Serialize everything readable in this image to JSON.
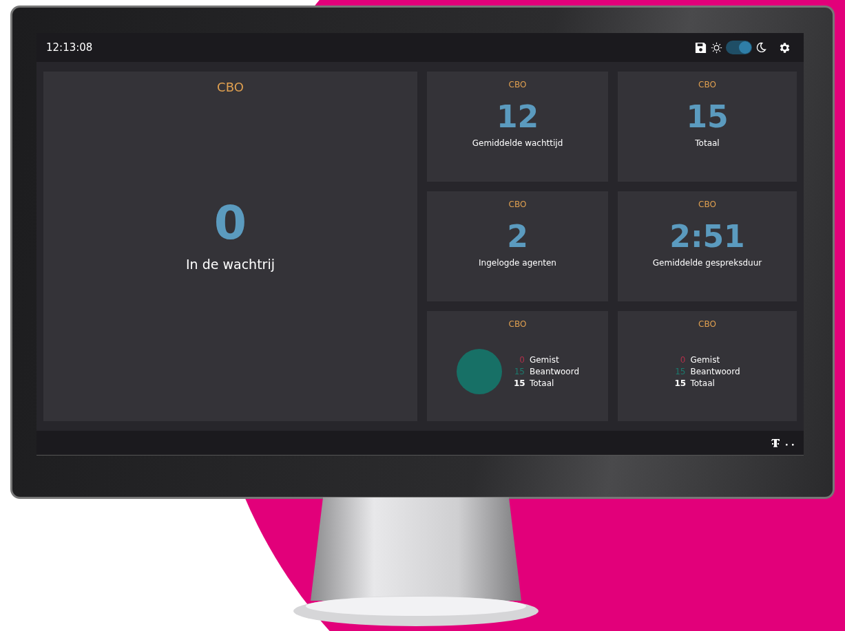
{
  "header": {
    "clock": "12:13:08",
    "dark_mode_toggle": {
      "on": true
    }
  },
  "main_panel": {
    "title": "CBO",
    "value": "0",
    "label": "In de wachtrij"
  },
  "stat_cards": [
    {
      "title": "CBO",
      "value": "12",
      "label": "Gemiddelde wachttijd"
    },
    {
      "title": "CBO",
      "value": "15",
      "label": "Totaal"
    },
    {
      "title": "CBO",
      "value": "2",
      "label": "Ingelogde agenten"
    },
    {
      "title": "CBO",
      "value": "2:51",
      "label": "Gemiddelde gespreksduur"
    }
  ],
  "summary_cards": [
    {
      "title": "CBO",
      "kind": "pie",
      "rows": [
        {
          "kind": "missed",
          "count": "0",
          "label": "Gemist"
        },
        {
          "kind": "answered",
          "count": "15",
          "label": "Beantwoord"
        },
        {
          "kind": "total",
          "count": "15",
          "label": "Totaal"
        }
      ]
    },
    {
      "title": "CBO",
      "kind": "plain",
      "rows": [
        {
          "kind": "missed",
          "count": "0",
          "label": "Gemist"
        },
        {
          "kind": "answered",
          "count": "15",
          "label": "Beantwoord"
        },
        {
          "kind": "total",
          "count": "15",
          "label": "Totaal"
        }
      ]
    }
  ]
}
